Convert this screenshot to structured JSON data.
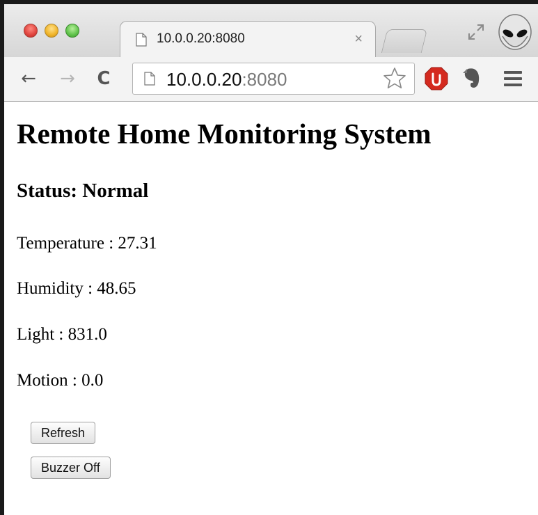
{
  "browser": {
    "tab_title": "10.0.0.20:8080",
    "tab_close": "×",
    "url_host": "10.0.0.20",
    "url_port": ":8080",
    "icons": {
      "back": "arrow-left-icon",
      "forward": "arrow-right-icon",
      "reload": "reload-icon",
      "bookmark": "star-icon",
      "extension_1": "adblock-stop-icon",
      "extension_2": "evernote-icon",
      "menu": "hamburger-menu-icon"
    }
  },
  "page": {
    "title": "Remote Home Monitoring System",
    "status": "Status: Normal",
    "readings": {
      "temperature": "Temperature : 27.31",
      "humidity": "Humidity : 48.65",
      "light": "Light : 831.0",
      "motion": "Motion : 0.0"
    },
    "buttons": {
      "refresh": "Refresh",
      "buzzer_off": "Buzzer Off"
    }
  }
}
